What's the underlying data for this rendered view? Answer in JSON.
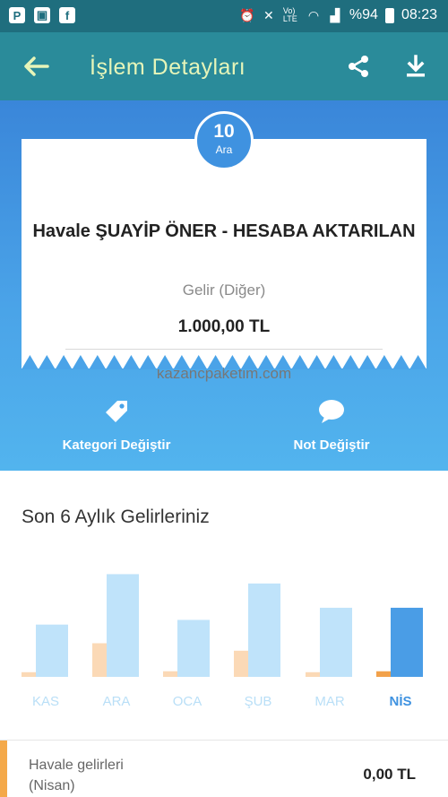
{
  "status_bar": {
    "battery_text": "%94",
    "time": "08:23",
    "network_label": "Vo) LTE"
  },
  "app_bar": {
    "title": "İşlem Detayları",
    "icons": [
      "back-arrow-icon",
      "share-icon",
      "download-icon"
    ]
  },
  "transaction": {
    "day": "10",
    "month": "Ara",
    "title": "Havale ŞUAYİP ÖNER - HESABA AKTARILAN",
    "category": "Gelir (Diğer)",
    "amount": "1.000,00 TL",
    "source": "kazancpaketim.com"
  },
  "actions": [
    {
      "label": "Kategori Değiştir",
      "icon": "tag-icon"
    },
    {
      "label": "Not Değiştir",
      "icon": "comment-icon"
    }
  ],
  "chart_section": {
    "title": "Son 6 Aylık Gelirleriniz"
  },
  "chart_data": {
    "type": "bar",
    "categories": [
      "KAS",
      "ARA",
      "OCA",
      "ŞUB",
      "MAR",
      "NİS"
    ],
    "series": [
      {
        "values": [
          5,
          36,
          6,
          28,
          5,
          6
        ],
        "color": "#fbd9b6"
      },
      {
        "values": [
          56,
          110,
          61,
          100,
          74,
          74
        ],
        "color": "#bfe3fa"
      }
    ],
    "highlight_index": 5,
    "highlight_colors": [
      "#f2a14a",
      "#4a9de6"
    ],
    "ylim": [
      0,
      120
    ],
    "grid": false
  },
  "bottom": {
    "label_line1": "Havale gelirleri",
    "label_line2": "(Nisan)",
    "value": "0,00 TL"
  },
  "colors": {
    "status_bar": "#1f6e7e",
    "app_bar": "#2a8b9a",
    "title_text": "#e6f5b9",
    "hero_top": "#3a86d9",
    "hero_bottom": "#52b4ee",
    "accent_orange": "#f4a94a"
  }
}
